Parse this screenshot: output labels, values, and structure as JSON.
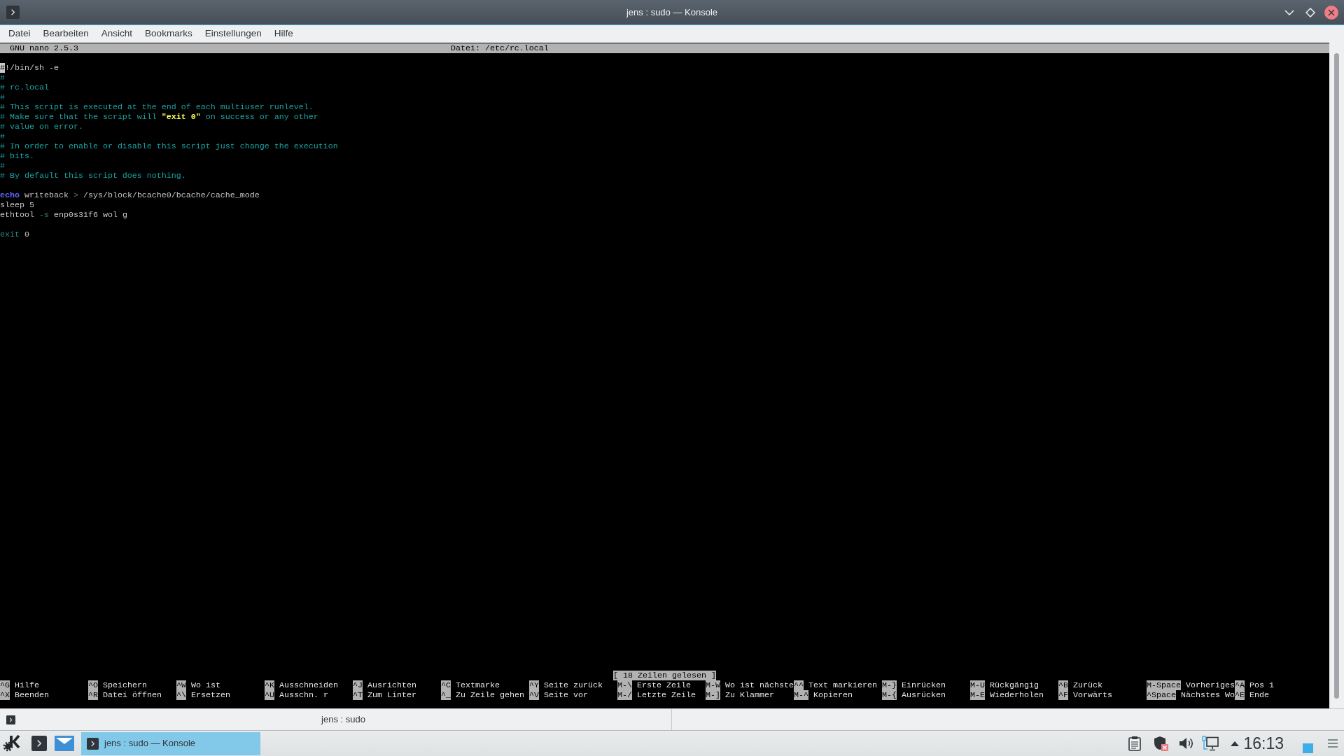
{
  "window": {
    "title": "jens : sudo — Konsole"
  },
  "menu_bar": {
    "items": [
      "Datei",
      "Bearbeiten",
      "Ansicht",
      "Bookmarks",
      "Einstellungen",
      "Hilfe"
    ]
  },
  "editor": {
    "version": "GNU nano 2.5.3",
    "file": "Datei: /etc/rc.local",
    "lines": [
      {
        "kind": "code",
        "segments": [
          {
            "kind": "cursor",
            "text": "#"
          },
          {
            "kind": "plain",
            "text": "!/bin/sh -e"
          }
        ]
      },
      {
        "kind": "code",
        "segments": [
          {
            "kind": "comment",
            "text": "#"
          }
        ]
      },
      {
        "kind": "code",
        "segments": [
          {
            "kind": "comment",
            "text": "# rc.local"
          }
        ]
      },
      {
        "kind": "code",
        "segments": [
          {
            "kind": "comment",
            "text": "#"
          }
        ]
      },
      {
        "kind": "code",
        "segments": [
          {
            "kind": "comment",
            "text": "# This script is executed at the end of each multiuser runlevel."
          }
        ]
      },
      {
        "kind": "code",
        "segments": [
          {
            "kind": "comment",
            "text": "# Make sure that the script will "
          },
          {
            "kind": "string",
            "text": "\"exit 0\""
          },
          {
            "kind": "comment",
            "text": " on success or any other"
          }
        ]
      },
      {
        "kind": "code",
        "segments": [
          {
            "kind": "comment",
            "text": "# value on error."
          }
        ]
      },
      {
        "kind": "code",
        "segments": [
          {
            "kind": "comment",
            "text": "#"
          }
        ]
      },
      {
        "kind": "code",
        "segments": [
          {
            "kind": "comment",
            "text": "# In order to enable or disable this script just change the execution"
          }
        ]
      },
      {
        "kind": "code",
        "segments": [
          {
            "kind": "comment",
            "text": "# bits."
          }
        ]
      },
      {
        "kind": "code",
        "segments": [
          {
            "kind": "comment",
            "text": "#"
          }
        ]
      },
      {
        "kind": "code",
        "segments": [
          {
            "kind": "comment",
            "text": "# By default this script does nothing."
          }
        ]
      },
      {
        "kind": "blank"
      },
      {
        "kind": "code",
        "segments": [
          {
            "kind": "keyword",
            "text": "echo"
          },
          {
            "kind": "plain",
            "text": " writeback "
          },
          {
            "kind": "operator",
            "text": ">"
          },
          {
            "kind": "plain",
            "text": " /sys/block/bcache0/bcache/cache_mode"
          }
        ]
      },
      {
        "kind": "code",
        "segments": [
          {
            "kind": "plain",
            "text": "sleep 5"
          }
        ]
      },
      {
        "kind": "code",
        "segments": [
          {
            "kind": "plain",
            "text": "ethtool "
          },
          {
            "kind": "option",
            "text": "-s"
          },
          {
            "kind": "plain",
            "text": " enp0s31f6 wol g"
          }
        ]
      },
      {
        "kind": "blank"
      },
      {
        "kind": "code",
        "segments": [
          {
            "kind": "builtin",
            "text": "exit"
          },
          {
            "kind": "plain",
            "text": " 0"
          }
        ]
      }
    ],
    "status": "[ 18 Zeilen gelesen ]",
    "shortcut_rows": [
      [
        {
          "key": "^G",
          "label": "Hilfe"
        },
        {
          "key": "^O",
          "label": "Speichern"
        },
        {
          "key": "^W",
          "label": "Wo ist"
        },
        {
          "key": "^K",
          "label": "Ausschneiden"
        },
        {
          "key": "^J",
          "label": "Ausrichten"
        },
        {
          "key": "^C",
          "label": "Textmarke"
        },
        {
          "key": "^Y",
          "label": "Seite zurück"
        },
        {
          "key": "M-\\",
          "label": "Erste Zeile"
        },
        {
          "key": "M-W",
          "label": "Wo ist nächste"
        },
        {
          "key": "^^",
          "label": "Text markieren"
        },
        {
          "key": "M-}",
          "label": "Einrücken"
        },
        {
          "key": "M-U",
          "label": "Rückgängig"
        },
        {
          "key": "^B",
          "label": "Zurück"
        },
        {
          "key": "M-Space",
          "label": "Vorheriges"
        },
        {
          "key": "^A",
          "label": "Pos 1"
        }
      ],
      [
        {
          "key": "^X",
          "label": "Beenden"
        },
        {
          "key": "^R",
          "label": "Datei öffnen"
        },
        {
          "key": "^\\",
          "label": "Ersetzen"
        },
        {
          "key": "^U",
          "label": "Ausschn. r"
        },
        {
          "key": "^T",
          "label": "Zum Linter"
        },
        {
          "key": "^_",
          "label": "Zu Zeile gehen"
        },
        {
          "key": "^V",
          "label": "Seite vor"
        },
        {
          "key": "M-/",
          "label": "Letzte Zeile"
        },
        {
          "key": "M-]",
          "label": "Zu Klammer"
        },
        {
          "key": "M-^",
          "label": "Kopieren"
        },
        {
          "key": "M-{",
          "label": "Ausrücken"
        },
        {
          "key": "M-E",
          "label": "Wiederholen"
        },
        {
          "key": "^F",
          "label": "Vorwärts"
        },
        {
          "key": "^Space",
          "label": "Nächstes Wo"
        },
        {
          "key": "^E",
          "label": "Ende"
        }
      ]
    ]
  },
  "tab_bar": {
    "tabs": [
      {
        "label": "jens : sudo"
      }
    ]
  },
  "taskbar": {
    "tasks": [
      {
        "label": "jens : sudo — Konsole",
        "selected": true
      }
    ],
    "clock": "16:13"
  }
}
